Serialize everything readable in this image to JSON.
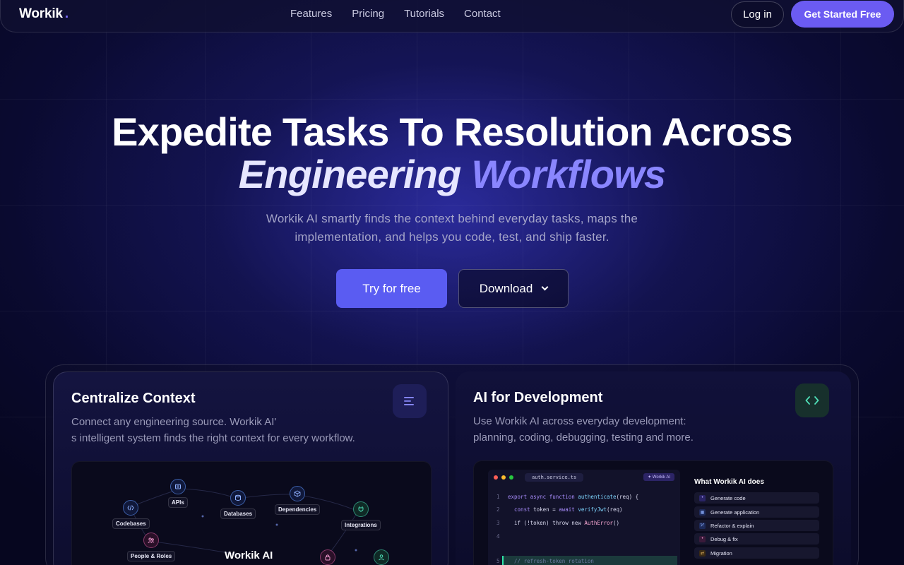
{
  "nav": {
    "logo": "Workik",
    "logo_dot": ".",
    "links": [
      "Features",
      "Pricing",
      "Tutorials",
      "Contact"
    ],
    "login": "Log in",
    "cta": "Get Started Free"
  },
  "hero": {
    "title_line1": "Expedite Tasks To Resolution Across",
    "title_line2_a": "Engineering",
    "title_line2_b": "Workflows",
    "subtitle_line1": "Workik AI smartly finds the context behind everyday tasks, maps the",
    "subtitle_line2": "implementation, and helps you code, test, and ship faster.",
    "try_button": "Try for free",
    "download_button": "Download"
  },
  "cards": {
    "left": {
      "title": "Centralize Context",
      "desc_line1": "Connect any engineering source. Workik AI'",
      "desc_line2": "s intelligent system finds the right context for every workflow.",
      "icon": "lines-icon",
      "graph": {
        "nodes": [
          "Codebases",
          "APIs",
          "Databases",
          "Dependencies",
          "Integrations",
          "People & Roles"
        ],
        "center_label": "Workik AI"
      }
    },
    "right": {
      "title": "AI for Development",
      "desc_line1": "Use Workik AI across everyday development:",
      "desc_line2": "planning, coding, debugging, testing and more.",
      "icon": "code-brackets-icon",
      "editor": {
        "file_tab": "auth.service.ts",
        "ai_tag": "✦ Workik AI",
        "lines": [
          {
            "n": "1",
            "text": "export async function authenticate(req) {"
          },
          {
            "n": "2",
            "text": "  const token = await verifyJwt(req)"
          },
          {
            "n": "3",
            "text": "  if (!token) throw new AuthError()"
          },
          {
            "n": "4",
            "text": ""
          },
          {
            "n": "5",
            "text": "  // refresh-token rotation"
          }
        ]
      },
      "does": {
        "title": "What Workik AI does",
        "items": [
          "Generate code",
          "Generate application",
          "Refactor & explain",
          "Debug & fix",
          "Migration"
        ]
      }
    }
  },
  "colors": {
    "accent": "#6b5bf2",
    "primary_button": "#5a5cf2",
    "gradient_word": "#8a86ff"
  }
}
